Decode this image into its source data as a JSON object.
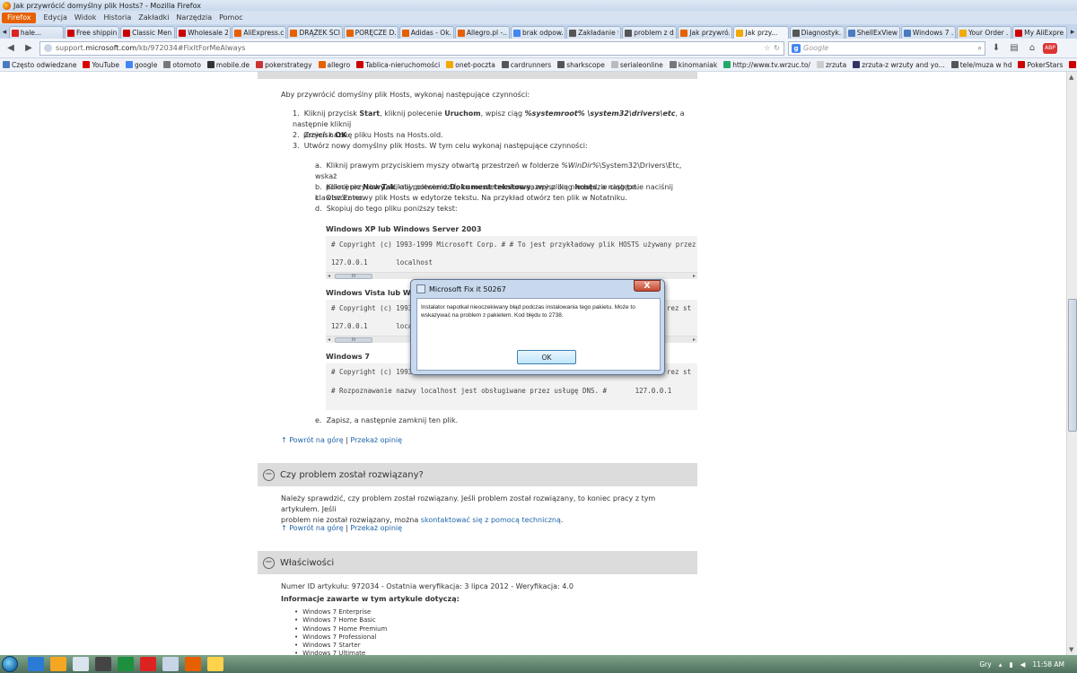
{
  "window": {
    "title": "Jak przywrócić domyślny plik Hosts? - Mozilla Firefox"
  },
  "menubar": {
    "button": "Firefox",
    "items": [
      "Edycja",
      "Widok",
      "Historia",
      "Zakładki",
      "Narzędzia",
      "Pomoc"
    ]
  },
  "tabs": [
    {
      "label": "hale...",
      "color": "#d22"
    },
    {
      "label": "Free shippin...",
      "color": "#c00"
    },
    {
      "label": "Classic Men...",
      "color": "#c00"
    },
    {
      "label": "Wholesale 2...",
      "color": "#c00"
    },
    {
      "label": "AliExpress.c...",
      "color": "#e66000"
    },
    {
      "label": "DRĄŻEK ŚCI...",
      "color": "#e66000"
    },
    {
      "label": "PORĘCZE D...",
      "color": "#e66000"
    },
    {
      "label": "Adidas - Ok...",
      "color": "#e66000"
    },
    {
      "label": "Allegro.pl -...",
      "color": "#e66000"
    },
    {
      "label": "brak odpow...",
      "color": "#4285f4"
    },
    {
      "label": "Zakładanie t...",
      "color": "#555"
    },
    {
      "label": "problem z d...",
      "color": "#555"
    },
    {
      "label": "Jak przywró...",
      "color": "#e66000"
    },
    {
      "label": "Jak przy...",
      "color": "#f2a900",
      "active": true
    },
    {
      "label": "Diagnostyk...",
      "color": "#555"
    },
    {
      "label": "ShellExView ...",
      "color": "#4a7ac0"
    },
    {
      "label": "Windows 7 ...",
      "color": "#4a7ac0"
    },
    {
      "label": "Your Order ...",
      "color": "#f2a900"
    },
    {
      "label": "My AliExpre...",
      "color": "#c00"
    }
  ],
  "nav": {
    "url_prefix": "support.",
    "url_domain": "microsoft.com",
    "url_path": "/kb/972034#FixItForMeAlways",
    "search_placeholder": "Google"
  },
  "bookmarks": [
    {
      "label": "Często odwiedzane",
      "color": "#4a7ac0"
    },
    {
      "label": "YouTube",
      "color": "#d00"
    },
    {
      "label": "google",
      "color": "#4285f4"
    },
    {
      "label": "otomoto",
      "color": "#777"
    },
    {
      "label": "mobile.de",
      "color": "#333"
    },
    {
      "label": "pokerstrategy",
      "color": "#c33"
    },
    {
      "label": "allegro",
      "color": "#e66000"
    },
    {
      "label": "Tablica-nieruchomości",
      "color": "#c00"
    },
    {
      "label": "onet-poczta",
      "color": "#f2a900"
    },
    {
      "label": "cardrunners",
      "color": "#555"
    },
    {
      "label": "sharkscope",
      "color": "#555"
    },
    {
      "label": "serialeonline",
      "color": "#bbb"
    },
    {
      "label": "kinomaniak",
      "color": "#777"
    },
    {
      "label": "http://www.tv.wrzuc.to/",
      "color": "#2a6"
    },
    {
      "label": "zrzuta",
      "color": "#ccc"
    },
    {
      "label": "zrzuta-z wrzuty and yo...",
      "color": "#336"
    },
    {
      "label": "tele/muza w hd",
      "color": "#555"
    },
    {
      "label": "PokerStars",
      "color": "#c00"
    },
    {
      "label": "PokerTexas",
      "color": "#c00"
    },
    {
      "label": "PayPal",
      "color": "#1a4d9b"
    }
  ],
  "article": {
    "intro": "Aby przywrócić domyślny plik Hosts, wykonaj następujące czynności:",
    "step1_a": "Kliknij przycisk ",
    "step1_start": "Start",
    "step1_b": ", kliknij polecenie ",
    "step1_run": "Uruchom",
    "step1_c": ", wpisz ciąg ",
    "step1_path": "%systemroot% \\system32\\drivers\\etc",
    "step1_d": ", a następnie kliknij",
    "step1_e": "przycisk ",
    "step1_ok": "OK",
    "step1_f": ".",
    "step2": "Zmień nazwę pliku Hosts na Hosts.old.",
    "step3": "Utwórz nowy domyślny plik Hosts. W tym celu wykonaj następujące czynności:",
    "sub_a_1": "Kliknij prawym przyciskiem myszy otwartą przestrzeń w folderze ",
    "sub_a_var": "%WinDir%",
    "sub_a_2": "\\System32\\Drivers\\Etc, wskaż",
    "sub_a_3": "polecenie ",
    "sub_a_new": "Nowy",
    "sub_a_4": ", kliknij polecenie ",
    "sub_a_doc": "Dokument tekstowy",
    "sub_a_5": ", wpisz ciąg ",
    "sub_a_hosts": "hosts",
    "sub_a_6": ", a następnie naciśnij klawisz Enter.",
    "sub_b_1": "Kliknij przycisk ",
    "sub_b_yes": "Tak",
    "sub_b_2": ", aby potwierdzić, że rozszerzeniem nazwy pliku nie będzie ciąg txt.",
    "sub_c": "Otwórz nowy plik Hosts w edytorze tekstu. Na przykład otwórz ten plik w Notatniku.",
    "sub_d": "Skopiuj do tego pliku poniższy tekst:",
    "sub_e": "Zapisz, a następnie zamknij ten plik.",
    "xp_heading": "Windows XP lub Windows Server 2003",
    "xp_line1": "# Copyright (c) 1993-1999 Microsoft Corp. # # To jest przykładowy plik HOSTS używany przez st",
    "xp_line2": "127.0.0.1       localhost",
    "vista_heading": "Windows Vista lub Wind",
    "vista_line1": "# Copyright (c) 1993",
    "vista_line1_tail": "rez st",
    "vista_line2": "127.0.0.1       loca",
    "w7_heading": "Windows 7",
    "w7_line1": "# Copyright (c) 1993",
    "w7_line1_tail": "rez st",
    "w7_line2": "# Rozpoznawanie nazwy localhost jest obsługiwane przez usługę DNS. #       127.0.0.1       lo",
    "scroll_thumb": "III",
    "top_link": "↑ Powrót na górę",
    "sep": "|",
    "feedback_link": "Przekaż opinię",
    "solved_heading": "Czy problem został rozwiązany?",
    "solved_text_1": "Należy sprawdzić, czy problem został rozwiązany. Jeśli problem został rozwiązany, to koniec pracy z tym artykułem. Jeśli",
    "solved_text_2": "problem nie został rozwiązany, można ",
    "solved_link": "skontaktować się z pomocą techniczną",
    "solved_text_3": ".",
    "props_heading": "Właściwości",
    "props_meta": "Numer ID artykułu: 972034 - Ostatnia weryfikacja: 3 lipca 2012 - Weryfikacja: 4.0",
    "props_applies": "Informacje zawarte w tym artykule dotyczą:",
    "products": [
      "Windows 7 Enterprise",
      "Windows 7 Home Basic",
      "Windows 7 Home Premium",
      "Windows 7 Professional",
      "Windows 7 Starter",
      "Windows 7 Ultimate"
    ]
  },
  "dialog": {
    "title": "Microsoft Fix it 50267",
    "close": "X",
    "message": "Instalator napotkał nieoczekiwany błąd podczas instalowania tego pakietu. Może to wskazywać na problem z pakietem. Kod błędu to 2738.",
    "ok": "OK"
  },
  "taskbar": {
    "lang": "Gry",
    "time": "11:58 AM",
    "icons": [
      "#2b7bd6",
      "#f5a623",
      "#d9e4ef",
      "#444",
      "#1e8f3e",
      "#d22",
      "#c7d5e6",
      "#e66000",
      "#ffd24c"
    ]
  }
}
